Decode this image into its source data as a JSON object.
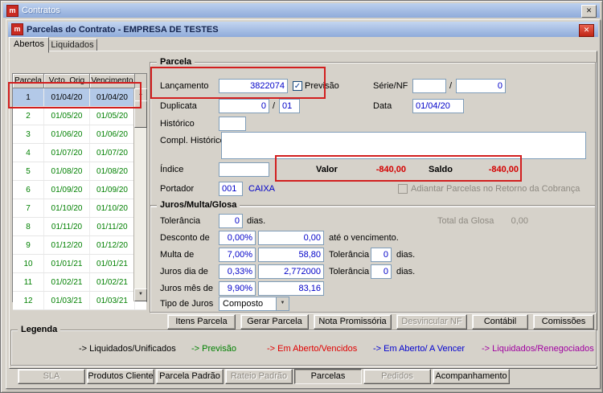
{
  "icons": {
    "app_logo": "m",
    "close": "✕",
    "check": "✓",
    "arrow_down": "▼",
    "scroll_up": "▲",
    "scroll_down": "▼"
  },
  "outer_window": {
    "title": "Contratos"
  },
  "inner_window": {
    "title": "Parcelas do Contrato - EMPRESA DE TESTES"
  },
  "tabs": {
    "abertos": "Abertos",
    "liquidados": "Liquidados"
  },
  "table": {
    "columns": [
      "Parcela",
      "Vcto. Orig",
      "Vencimento"
    ],
    "rows": [
      {
        "parcela": "1",
        "vcto": "01/04/20",
        "venc": "01/04/20",
        "color": "#000000"
      },
      {
        "parcela": "2",
        "vcto": "01/05/20",
        "venc": "01/05/20",
        "color": "#008000"
      },
      {
        "parcela": "3",
        "vcto": "01/06/20",
        "venc": "01/06/20",
        "color": "#008000"
      },
      {
        "parcela": "4",
        "vcto": "01/07/20",
        "venc": "01/07/20",
        "color": "#008000"
      },
      {
        "parcela": "5",
        "vcto": "01/08/20",
        "venc": "01/08/20",
        "color": "#008000"
      },
      {
        "parcela": "6",
        "vcto": "01/09/20",
        "venc": "01/09/20",
        "color": "#008000"
      },
      {
        "parcela": "7",
        "vcto": "01/10/20",
        "venc": "01/10/20",
        "color": "#008000"
      },
      {
        "parcela": "8",
        "vcto": "01/11/20",
        "venc": "01/11/20",
        "color": "#008000"
      },
      {
        "parcela": "9",
        "vcto": "01/12/20",
        "venc": "01/12/20",
        "color": "#008000"
      },
      {
        "parcela": "10",
        "vcto": "01/01/21",
        "venc": "01/01/21",
        "color": "#008000"
      },
      {
        "parcela": "11",
        "vcto": "01/02/21",
        "venc": "01/02/21",
        "color": "#008000"
      },
      {
        "parcela": "12",
        "vcto": "01/03/21",
        "venc": "01/03/21",
        "color": "#008000"
      }
    ]
  },
  "parcela_group": {
    "title": "Parcela",
    "lancamento_label": "Lançamento",
    "lancamento_value": "3822074",
    "previsao_label": "Previsão",
    "serie_nf_label": "Série/NF",
    "serie_nf_value1": "",
    "serie_nf_sep": "/",
    "serie_nf_value2": "0",
    "duplicata_label": "Duplicata",
    "duplicata_value1": "0",
    "duplicata_sep": "/",
    "duplicata_value2": "01",
    "data_label": "Data",
    "data_value": "01/04/20",
    "historico_label": "Histórico",
    "historico_value": "",
    "compl_historico_label": "Compl. Histórico",
    "compl_historico_value": "",
    "indice_label": "Índice",
    "indice_value": "",
    "valor_label": "Valor",
    "valor_value": "-840,00",
    "saldo_label": "Saldo",
    "saldo_value": "-840,00",
    "portador_label": "Portador",
    "portador_code": "001",
    "portador_name": "CAIXA",
    "adiantar_label": "Adiantar Parcelas no Retorno da Cobrança"
  },
  "juros_group": {
    "title": "Juros/Multa/Glosa",
    "tolerancia_label": "Tolerância",
    "tolerancia_value": "0",
    "tolerancia_suffix": "dias.",
    "total_glosa_label": "Total da Glosa",
    "total_glosa_value": "0,00",
    "desconto_label": "Desconto de",
    "desconto_pct": "0,00%",
    "desconto_value": "0,00",
    "desconto_suffix": "até o vencimento.",
    "multa_label": "Multa de",
    "multa_pct": "7,00%",
    "multa_value": "58,80",
    "multa_tol_label": "Tolerância",
    "multa_tol_value": "0",
    "multa_suffix": "dias.",
    "juros_dia_label": "Juros dia de",
    "juros_dia_pct": "0,33%",
    "juros_dia_value": "2,772000",
    "juros_dia_tol_label": "Tolerância",
    "juros_dia_tol_value": "0",
    "juros_dia_suffix": "dias.",
    "juros_mes_label": "Juros mês de",
    "juros_mes_pct": "9,90%",
    "juros_mes_value": "83,16",
    "tipo_juros_label": "Tipo de Juros",
    "tipo_juros_value": "Composto"
  },
  "action_buttons": {
    "itens": "Itens Parcela",
    "gerar": "Gerar Parcela",
    "nota": "Nota Promissória",
    "desvincular": "Desvincular NF",
    "contabil": "Contábil",
    "comissoes": "Comissões"
  },
  "legenda": {
    "title": "Legenda",
    "items": [
      {
        "label": "-> Liquidados/Unificados",
        "color": "#000000"
      },
      {
        "label": "-> Previsão",
        "color": "#008000"
      },
      {
        "label": "-> Em Aberto/Vencidos",
        "color": "#e00000"
      },
      {
        "label": "-> Em Aberto/ A Vencer",
        "color": "#0000d0"
      },
      {
        "label": "-> Liquidados/Renegociados",
        "color": "#a000a0"
      }
    ]
  },
  "bottom_buttons": {
    "sla": "SLA",
    "produtos_cliente": "Produtos Cliente",
    "parcela_padrao": "Parcela Padrão",
    "rateio_padrao": "Rateio Padrão",
    "parcelas": "Parcelas",
    "pedidos": "Pedidos",
    "acompanhamento": "Acompanhamento"
  }
}
